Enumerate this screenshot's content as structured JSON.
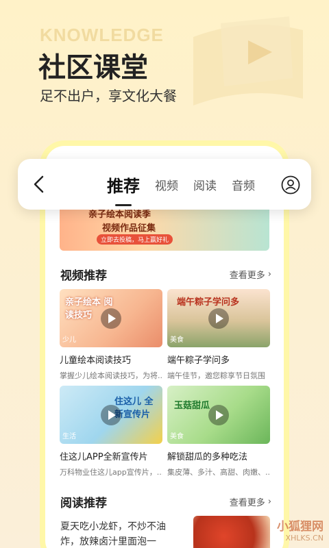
{
  "hero": {
    "watermark": "KNOWLEDGE",
    "title": "社区课堂",
    "subtitle": "足不出户，享文化大餐"
  },
  "nav": {
    "tabs": [
      "推荐",
      "视频",
      "阅读",
      "音频"
    ],
    "active_tab": "推荐"
  },
  "banner": {
    "line1": "亲子绘本阅读季",
    "line2": "视频作品征集",
    "line3": "立即去投稿，马上赢好礼"
  },
  "video_section": {
    "title": "视频推荐",
    "more": "查看更多",
    "cards": [
      {
        "tag": "少儿",
        "thumb_text": "亲子绘本 阅读技巧",
        "title": "儿童绘本阅读技巧",
        "desc": "掌握少儿绘本阅读技巧，为将..."
      },
      {
        "tag": "美食",
        "thumb_text": "端午粽子学问多",
        "title": "端午粽子学问多",
        "desc": "端午佳节，邀您粽享节日氛围"
      },
      {
        "tag": "生活",
        "thumb_text": "住这儿 全新宣传片",
        "title": "住这儿APP全新宣传片",
        "desc": "万科物业住这儿app宣传片，..."
      },
      {
        "tag": "美食",
        "thumb_text": "玉菇甜瓜",
        "title": "解锁甜瓜的多种吃法",
        "desc": "集皮薄、多汁、高甜、肉嫩、..."
      }
    ]
  },
  "read_section": {
    "title": "阅读推荐",
    "more": "查看更多",
    "article": "夏天吃小龙虾，不炒不油炸，放辣卤汁里面泡一泡，..."
  },
  "watermark_logo": {
    "name": "小狐狸网",
    "url": "XHLKS.CN"
  },
  "colors": {
    "accent": "#fff7a8",
    "background": "#fdf0cf",
    "text": "#222222"
  }
}
